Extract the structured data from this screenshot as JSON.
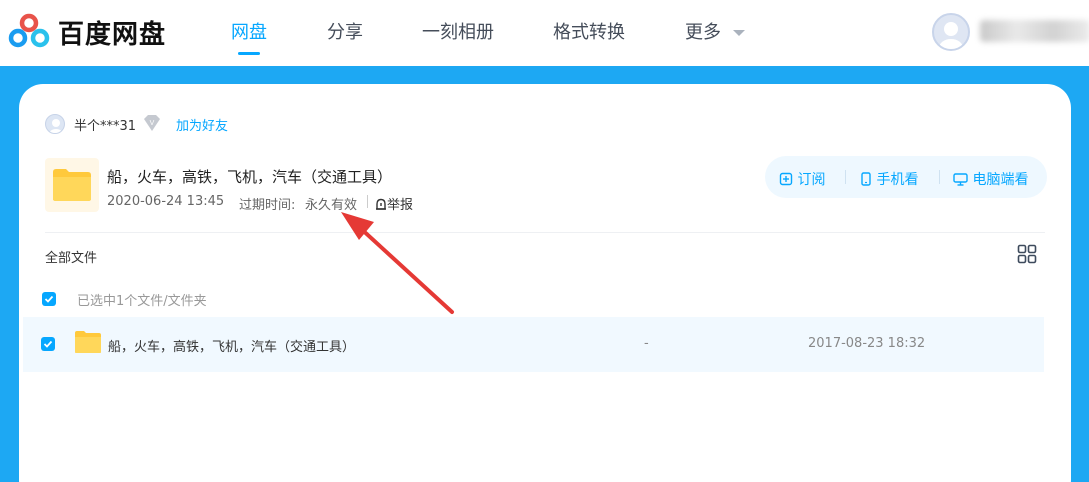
{
  "header": {
    "brand": "百度网盘",
    "nav": [
      {
        "label": "网盘",
        "active": true
      },
      {
        "label": "分享",
        "active": false
      },
      {
        "label": "一刻相册",
        "active": false
      },
      {
        "label": "格式转换",
        "active": false
      },
      {
        "label": "更多",
        "active": false
      }
    ],
    "accent_color": "#06a7ff"
  },
  "sharer": {
    "name": "半个***31",
    "add_friend_label": "加为好友"
  },
  "share": {
    "title": "船，火车，高铁，飞机，汽车（交通工具）",
    "date": "2020-06-24 13:45",
    "expire_label": "过期时间:",
    "expire_value": "永久有效",
    "report_label": "举报"
  },
  "actions": [
    {
      "label": "订阅",
      "icon": "subscribe-icon"
    },
    {
      "label": "手机看",
      "icon": "phone-icon"
    },
    {
      "label": "电脑端看",
      "icon": "monitor-icon"
    }
  ],
  "file_list": {
    "breadcrumb": "全部文件",
    "selection_text": "已选中1个文件/文件夹",
    "rows": [
      {
        "name": "船，火车，高铁，飞机，汽车（交通工具）",
        "size": "-",
        "modified": "2017-08-23 18:32",
        "checked": true
      }
    ]
  },
  "annotation": {
    "color": "#e53935"
  },
  "page_background": "#1da8f3"
}
